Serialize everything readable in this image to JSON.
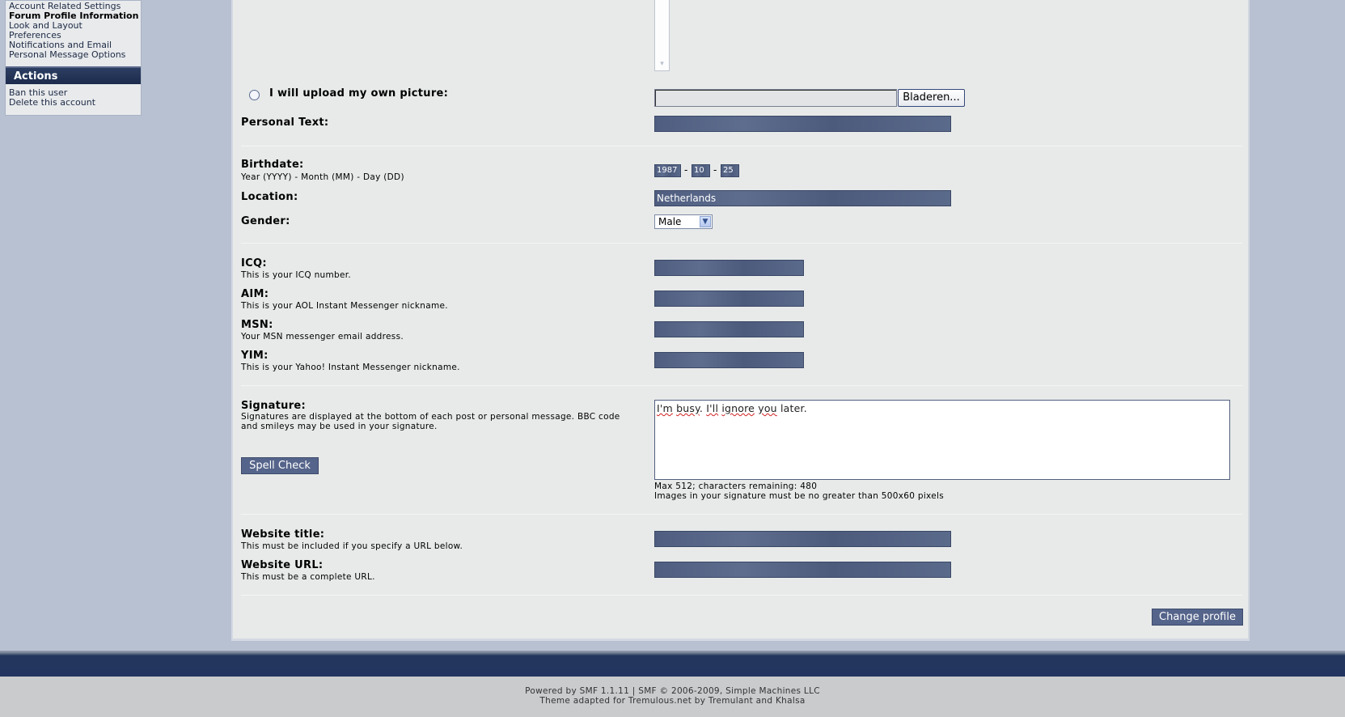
{
  "sidebar": {
    "profile_links": [
      "Account Related Settings",
      "Forum Profile Information",
      "Look and Layout",
      "Preferences",
      "Notifications and Email",
      "Personal Message Options"
    ],
    "actions_title": "Actions",
    "action_links": [
      "Ban this user",
      "Delete this account"
    ]
  },
  "form": {
    "upload_label": "I will upload my own picture:",
    "browse_label": "Bladeren...",
    "personal_text_label": "Personal Text:",
    "personal_text_value": "",
    "birthdate_label": "Birthdate:",
    "birthdate_desc": "Year (YYYY) - Month (MM) - Day (DD)",
    "birth_year": "1987",
    "birth_month": "10",
    "birth_day": "25",
    "date_sep": "-",
    "location_label": "Location:",
    "location_value": "Netherlands",
    "gender_label": "Gender:",
    "gender_value": "Male",
    "icq_label": "ICQ:",
    "icq_desc": "This is your ICQ number.",
    "aim_label": "AIM:",
    "aim_desc": "This is your AOL Instant Messenger nickname.",
    "msn_label": "MSN:",
    "msn_desc": "Your MSN messenger email address.",
    "yim_label": "YIM:",
    "yim_desc": "This is your Yahoo! Instant Messenger nickname.",
    "signature_label": "Signature:",
    "signature_desc_1": "Signatures are displayed at the bottom of each post or personal message. BBC code",
    "signature_desc_2": "and smileys may be used in your signature.",
    "signature_words": [
      "I'm",
      "busy",
      ". ",
      "I'll",
      " ",
      "ignore",
      " ",
      "you",
      " later."
    ],
    "spell_check_label": "Spell Check",
    "sig_max_note": "Max 512; characters remaining: 480",
    "sig_image_note": "Images in your signature must be no greater than 500x60 pixels",
    "website_title_label": "Website title:",
    "website_title_desc": "This must be included if you specify a URL below.",
    "website_url_label": "Website URL:",
    "website_url_desc": "This must be a complete URL.",
    "change_profile_label": "Change profile"
  },
  "footer": {
    "line1": "Powered by SMF 1.1.11 | SMF © 2006-2009, Simple Machines LLC",
    "line2": "Theme adapted for Tremulous.net by Tremulant and Khalsa"
  }
}
